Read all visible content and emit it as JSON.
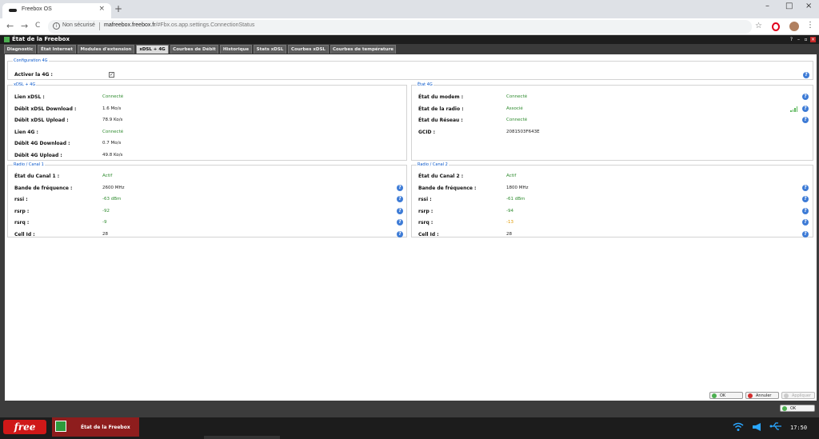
{
  "browser": {
    "tab_title": "Freebox OS",
    "tab_close": "×",
    "new_tab": "+",
    "window_controls": [
      "–",
      "□",
      "×"
    ],
    "nav": {
      "back": "←",
      "forward": "→",
      "reload": "C"
    },
    "security": "Non sécurisé",
    "url_host": "mafreebox.freebox.fr",
    "url_path": "/#Fbx.os.app.settings.ConnectionStatus"
  },
  "app": {
    "title": "État de la Freebox",
    "controls": [
      "?",
      "–",
      "▫",
      "×"
    ],
    "tabs": [
      {
        "label": "Diagnostic"
      },
      {
        "label": "État Internet"
      },
      {
        "label": "Modules d'extension"
      },
      {
        "label": "xDSL + 4G"
      },
      {
        "label": "Courbes de Débit"
      },
      {
        "label": "Historique"
      },
      {
        "label": "Stats xDSL"
      },
      {
        "label": "Courbes xDSL"
      },
      {
        "label": "Courbes de température"
      }
    ],
    "active_tab": "xDSL + 4G"
  },
  "config4g": {
    "legend": "Configuration 4G",
    "label": "Activer la 4G :",
    "checked": true,
    "check_mark": "✓"
  },
  "xdsl": {
    "legend": "xDSL + 4G",
    "rows": [
      {
        "label": "Lien xDSL :",
        "value": "Connecté"
      },
      {
        "label": "Débit xDSL Download :",
        "value": "1.6 Mo/s"
      },
      {
        "label": "Débit xDSL Upload :",
        "value": "78.9 Ko/s"
      },
      {
        "label": "Lien 4G :",
        "value": "Connecté"
      },
      {
        "label": "Débit 4G Download :",
        "value": "0.7 Mo/s"
      },
      {
        "label": "Débit 4G Upload :",
        "value": "49.8 Ko/s"
      }
    ]
  },
  "etat4g": {
    "legend": "État 4G",
    "rows": [
      {
        "label": "État du modem :",
        "value": "Connecté"
      },
      {
        "label": "État de la radio :",
        "value": "Associé"
      },
      {
        "label": "État du Réseau :",
        "value": "Connecté"
      },
      {
        "label": "GCID :",
        "value": "2081503F643E"
      }
    ]
  },
  "canal1": {
    "legend": "Radio / Canal 1",
    "rows": [
      {
        "label": "État du Canal 1 :",
        "value": "Actif"
      },
      {
        "label": "Bande de fréquence :",
        "value": "2600 MHz"
      },
      {
        "label": "rssi :",
        "value": "-63 dBm"
      },
      {
        "label": "rsrp :",
        "value": "-92"
      },
      {
        "label": "rsrq :",
        "value": "-9"
      },
      {
        "label": "Cell Id :",
        "value": "28"
      }
    ]
  },
  "canal2": {
    "legend": "Radio / Canal 2",
    "rows": [
      {
        "label": "État du Canal 2 :",
        "value": "Actif"
      },
      {
        "label": "Bande de fréquence :",
        "value": "1800 MHz"
      },
      {
        "label": "rssi :",
        "value": "-61 dBm"
      },
      {
        "label": "rsrp :",
        "value": "-94"
      },
      {
        "label": "rsrq :",
        "value": "-13"
      },
      {
        "label": "Cell Id :",
        "value": "28"
      }
    ]
  },
  "help_glyph": "?",
  "buttons": {
    "ok": "OK",
    "cancel": "Annuler",
    "apply": "Appliquer",
    "ok2": "OK"
  },
  "taskbar": {
    "logo": "free",
    "task_label": "État de la Freebox",
    "clock": "17:50",
    "tray_icons": [
      "wifi-icon",
      "megaphone-icon",
      "usb-icon"
    ]
  },
  "colors": {
    "status_green": "#2e8b2e",
    "status_orange": "#e09a00",
    "help_blue": "#3d7bd6",
    "free_red": "#cf1818"
  }
}
